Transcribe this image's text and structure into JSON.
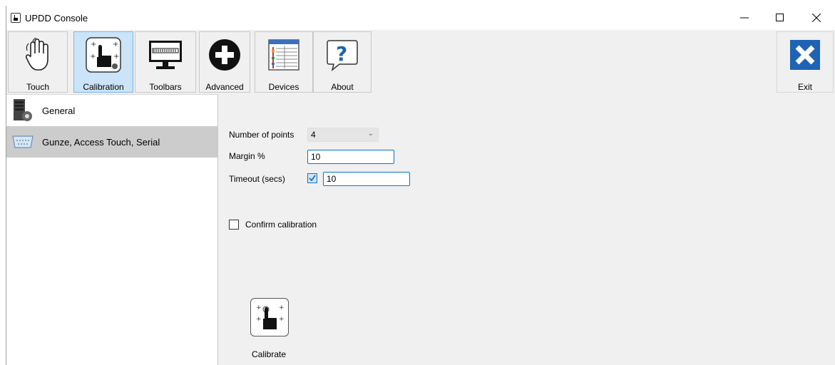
{
  "window": {
    "title": "UPDD Console"
  },
  "toolbar": {
    "items": [
      {
        "label": "Touch",
        "icon": "hand-touch-icon"
      },
      {
        "label": "Calibration",
        "icon": "calibration-icon",
        "active": true
      },
      {
        "label": "Toolbars",
        "icon": "monitor-toolbar-icon"
      },
      {
        "label": "Advanced",
        "icon": "plus-circle-icon"
      },
      {
        "label": "Devices",
        "icon": "devices-table-icon"
      },
      {
        "label": "About",
        "icon": "question-bubble-icon"
      }
    ],
    "exit_label": "Exit"
  },
  "sidebar": {
    "items": [
      {
        "label": "General",
        "icon": "server-gear-icon"
      },
      {
        "label": "Gunze, Access Touch, Serial",
        "icon": "serial-port-icon",
        "selected": true
      }
    ]
  },
  "settings": {
    "points_label": "Number of points",
    "points_value": "4",
    "margin_label": "Margin %",
    "margin_value": "10",
    "timeout_label": "Timeout (secs)",
    "timeout_checked": true,
    "timeout_value": "10",
    "confirm_label": "Confirm calibration",
    "confirm_checked": false,
    "calibrate_label": "Calibrate"
  },
  "colors": {
    "accent": "#0078d7",
    "active_tab_bg": "#cce4f7",
    "selected_row_bg": "#cccccc",
    "exit_blue": "#1e63b4"
  }
}
